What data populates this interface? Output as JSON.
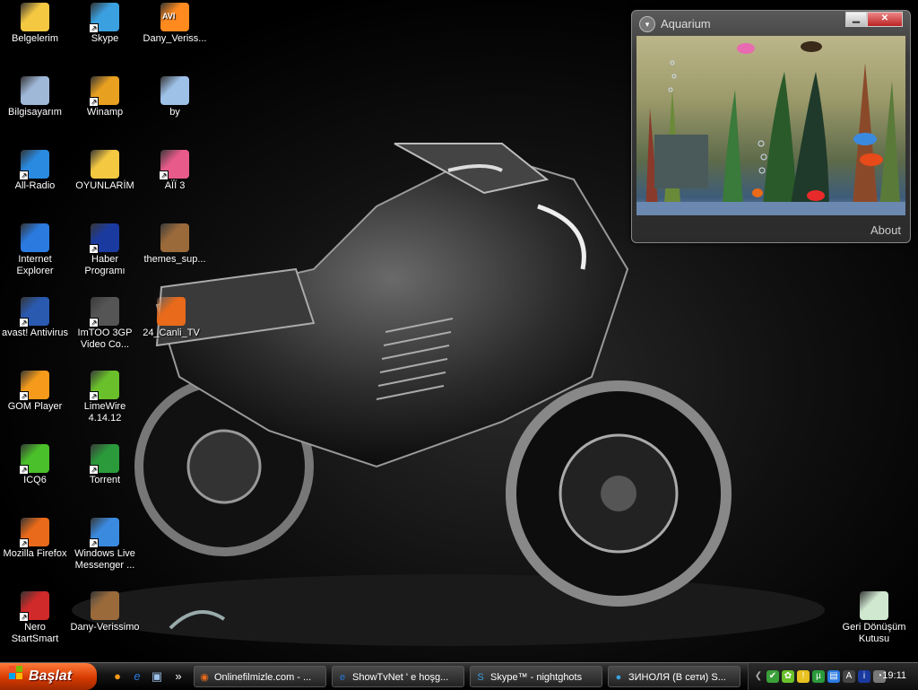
{
  "desktop_icons": [
    {
      "label": "Belgelerim",
      "color": "#f5c842",
      "shortcut": false
    },
    {
      "label": "Skype",
      "color": "#3aa0e0",
      "shortcut": true
    },
    {
      "label": "Dany_Veriss...",
      "color": "#ff8a1e",
      "shortcut": false,
      "badge": "AVI"
    },
    {
      "label": "Bilgisayarım",
      "color": "#9fb8d8",
      "shortcut": false
    },
    {
      "label": "Winamp",
      "color": "#e8a020",
      "shortcut": true
    },
    {
      "label": "by",
      "color": "#9ec1e8",
      "shortcut": false
    },
    {
      "label": "All-Radio",
      "color": "#2a8ae0",
      "shortcut": true
    },
    {
      "label": "OYUNLARİM",
      "color": "#f5c842",
      "shortcut": false
    },
    {
      "label": "AÏÏ 3",
      "color": "#e85a8a",
      "shortcut": true
    },
    {
      "label": "Internet Explorer",
      "color": "#2a7ae0",
      "shortcut": false
    },
    {
      "label": "Haber Programı",
      "color": "#1a3aa0",
      "shortcut": true
    },
    {
      "label": "themes_sup...",
      "color": "#9a6a3a",
      "shortcut": false
    },
    {
      "label": "avast! Antivirus",
      "color": "#2a5ab0",
      "shortcut": true
    },
    {
      "label": "ImTOO 3GP Video Co...",
      "color": "#555",
      "shortcut": true
    },
    {
      "label": "24_Canli_TV",
      "color": "#e86a1a",
      "shortcut": false
    },
    {
      "label": "GOM Player",
      "color": "#f59a1a",
      "shortcut": true
    },
    {
      "label": "LimeWire 4.14.12",
      "color": "#6ac02a",
      "shortcut": true
    },
    {
      "label": "ICQ6",
      "color": "#4ac02a",
      "shortcut": true
    },
    {
      "label": "Torrent",
      "color": "#2a9a3a",
      "shortcut": true
    },
    {
      "label": "Mozilla Firefox",
      "color": "#e86a1a",
      "shortcut": true
    },
    {
      "label": "Windows Live Messenger ...",
      "color": "#3a8ae0",
      "shortcut": true
    },
    {
      "label": "Nero StartSmart",
      "color": "#d02a2a",
      "shortcut": true
    },
    {
      "label": "Dany-Verissimo",
      "color": "#9a6a3a",
      "shortcut": false
    },
    {
      "label": "Geri Dönüşüm Kutusu",
      "color": "#cfe8cf",
      "shortcut": false
    }
  ],
  "gadget": {
    "title": "Aquarium",
    "about": "About",
    "min_glyph": "▁",
    "close_glyph": "✕",
    "menu_glyph": "▾"
  },
  "taskbar": {
    "start_label": "Başlat",
    "quicklaunch_more": "»",
    "tasks": [
      {
        "label": "Onlinefilmizle.com - ...",
        "icon": "firefox-icon",
        "glyph": "◉",
        "color": "#e86a1a"
      },
      {
        "label": "ShowTvNet ' e hoşg...",
        "icon": "ie-icon",
        "glyph": "e",
        "color": "#2a7ae0"
      },
      {
        "label": "Skype™ - nightghots",
        "icon": "skype-icon",
        "glyph": "S",
        "color": "#3aa0e0"
      },
      {
        "label": "ЗИНОЛЯ (В сети) S...",
        "icon": "chat-icon",
        "glyph": "●",
        "color": "#3aa0e0"
      }
    ],
    "clock": "19:11"
  }
}
